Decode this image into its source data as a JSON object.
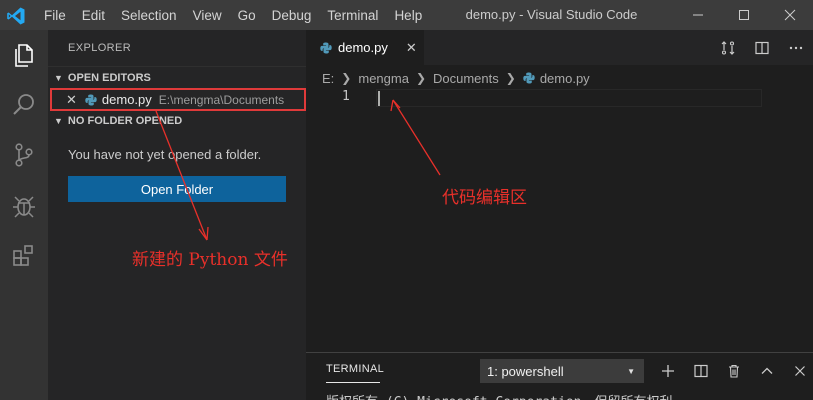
{
  "menubar": {
    "items": [
      "File",
      "Edit",
      "Selection",
      "View",
      "Go",
      "Debug",
      "Terminal",
      "Help"
    ]
  },
  "window": {
    "title": "demo.py - Visual Studio Code"
  },
  "sidebar": {
    "header": "EXPLORER",
    "open_editors": {
      "title": "OPEN EDITORS",
      "items": [
        {
          "name": "demo.py",
          "path": "E:\\mengma\\Documents"
        }
      ]
    },
    "no_folder": {
      "title": "NO FOLDER OPENED",
      "message": "You have not yet opened a folder.",
      "button_label": "Open Folder"
    }
  },
  "editor": {
    "tab": {
      "label": "demo.py"
    },
    "breadcrumb": [
      "E:",
      "mengma",
      "Documents",
      "demo.py"
    ],
    "line_numbers": [
      "1"
    ]
  },
  "panel": {
    "tab_label": "TERMINAL",
    "terminal_select": "1: powershell",
    "output_first_line": "版权所有 (C) Microsoft Corporation。保留所有权利。"
  },
  "annotations": {
    "editor_area": "代码编辑区",
    "new_file": "新建的 Python 文件"
  },
  "colors": {
    "titlebar": "#3c3c3c",
    "activitybar": "#333333",
    "sidebar": "#252526",
    "editor": "#1e1e1e",
    "accent_button": "#0e639c",
    "annotation": "#e8302a"
  },
  "icons": {
    "logo": "vscode-logo-icon",
    "activity": [
      "explorer-icon",
      "search-icon",
      "source-control-icon",
      "debug-icon",
      "extensions-icon"
    ]
  }
}
